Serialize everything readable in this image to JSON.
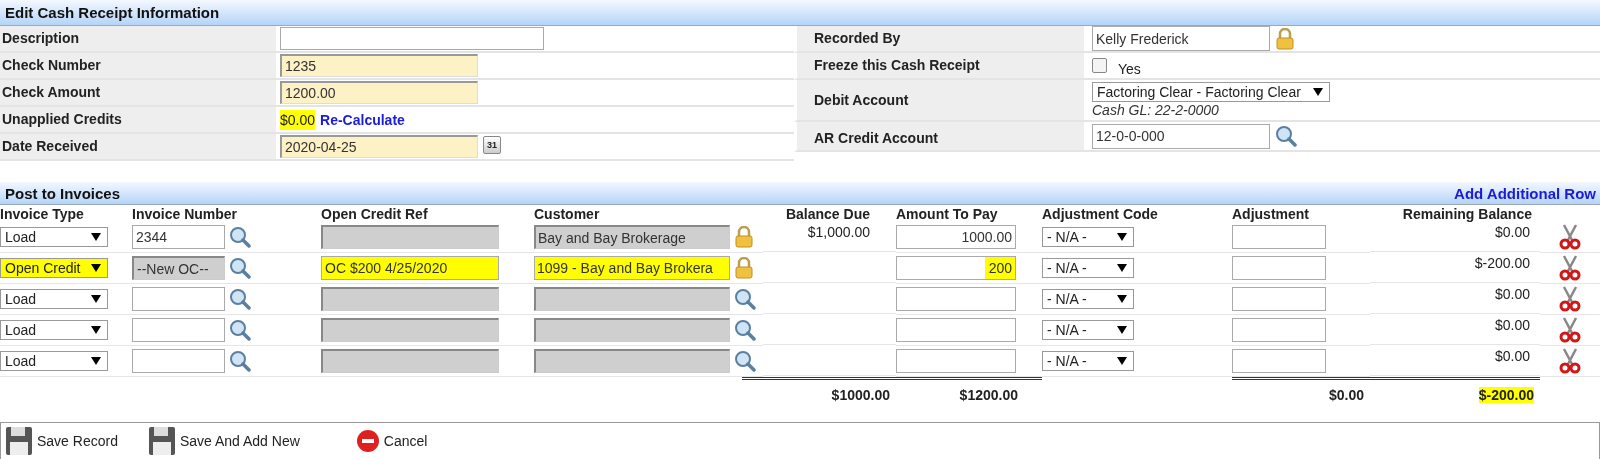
{
  "header": {
    "title": "Edit Cash Receipt Information"
  },
  "left_fields": [
    {
      "kind": "input",
      "label": "Description",
      "required": false
    },
    {
      "kind": "input",
      "label": "Check Number",
      "value": "1235",
      "required": true
    },
    {
      "kind": "input",
      "label": "Check Amount",
      "value": "1200.00",
      "required": true
    },
    {
      "kind": "amount",
      "label": "Unapplied Credits",
      "value": "$0.00",
      "highlighted": true,
      "link": "Re-Calculate"
    },
    {
      "kind": "date",
      "label": "Date Received",
      "value": "2020-04-25",
      "required": true,
      "calendar": "31"
    }
  ],
  "right_fields": [
    {
      "kind": "locked",
      "label": "Recorded By",
      "value": "Kelly Frederick"
    },
    {
      "kind": "checkbox",
      "label": "Freeze this Cash Receipt",
      "checked": false,
      "option": "Yes"
    },
    {
      "kind": "select",
      "label": "Debit Account",
      "value": "Factoring Clear - Factoring Clear",
      "note": "Cash GL: 22-2-0000"
    },
    {
      "kind": "lookup",
      "label": "AR Credit Account",
      "value": "12-0-0-000"
    }
  ],
  "invoices": {
    "title": "Post to Invoices",
    "add_link": "Add Additional Row",
    "columns": [
      "Invoice Type",
      "Invoice Number",
      "Open Credit Ref",
      "Customer",
      "Balance Due",
      "Amount To Pay",
      "Adjustment Code",
      "Adjustment",
      "Remaining Balance"
    ],
    "rows": [
      {
        "invoice_type": {
          "value": "Load",
          "highlighted": false
        },
        "invoice_number": {
          "value": "2344",
          "disabled": false
        },
        "open_credit_ref": {
          "disabled": true,
          "highlighted": false
        },
        "customer": {
          "value": "Bay and Bay Brokerage",
          "disabled": true,
          "highlighted": false,
          "locked": true
        },
        "balance_due": "$1,000.00",
        "amount_to_pay": {
          "value": "1000.00",
          "highlighted": false
        },
        "adjustment_code": "- N/A -",
        "remaining_balance": "$0.00"
      },
      {
        "invoice_type": {
          "value": "Open Credit",
          "highlighted": true
        },
        "invoice_number": {
          "value": "--New OC--",
          "disabled": true
        },
        "open_credit_ref": {
          "value": "OC $200 4/25/2020",
          "disabled": false,
          "highlighted": true
        },
        "customer": {
          "value": "1099 - Bay and Bay Brokera",
          "disabled": false,
          "highlighted": true,
          "locked": true
        },
        "amount_to_pay": {
          "value": "200",
          "highlighted": true
        },
        "adjustment_code": "- N/A -",
        "remaining_balance": "$-200.00"
      },
      {
        "invoice_type": {
          "value": "Load",
          "highlighted": false
        },
        "invoice_number": {
          "disabled": false
        },
        "open_credit_ref": {
          "disabled": true,
          "highlighted": false
        },
        "customer": {
          "disabled": true,
          "highlighted": false,
          "locked": false
        },
        "amount_to_pay": {
          "highlighted": false
        },
        "adjustment_code": "- N/A -",
        "remaining_balance": "$0.00"
      },
      {
        "invoice_type": {
          "value": "Load",
          "highlighted": false
        },
        "invoice_number": {
          "disabled": false
        },
        "open_credit_ref": {
          "disabled": true,
          "highlighted": false
        },
        "customer": {
          "disabled": true,
          "highlighted": false,
          "locked": false
        },
        "amount_to_pay": {
          "highlighted": false
        },
        "adjustment_code": "- N/A -",
        "remaining_balance": "$0.00"
      },
      {
        "invoice_type": {
          "value": "Load",
          "highlighted": false
        },
        "invoice_number": {
          "disabled": false
        },
        "open_credit_ref": {
          "disabled": true,
          "highlighted": false
        },
        "customer": {
          "disabled": true,
          "highlighted": false,
          "locked": false
        },
        "amount_to_pay": {
          "highlighted": false
        },
        "adjustment_code": "- N/A -",
        "remaining_balance": "$0.00"
      }
    ],
    "totals": {
      "balance_due": "$1000.00",
      "amount_to_pay": "$1200.00",
      "adjustment": "$0.00",
      "remaining_balance": {
        "value": "$-200.00",
        "highlighted": true
      }
    }
  },
  "actions": [
    {
      "kind": "save",
      "label": "Save Record"
    },
    {
      "kind": "save",
      "label": "Save And Add New"
    },
    {
      "kind": "cancel",
      "label": "Cancel"
    }
  ]
}
